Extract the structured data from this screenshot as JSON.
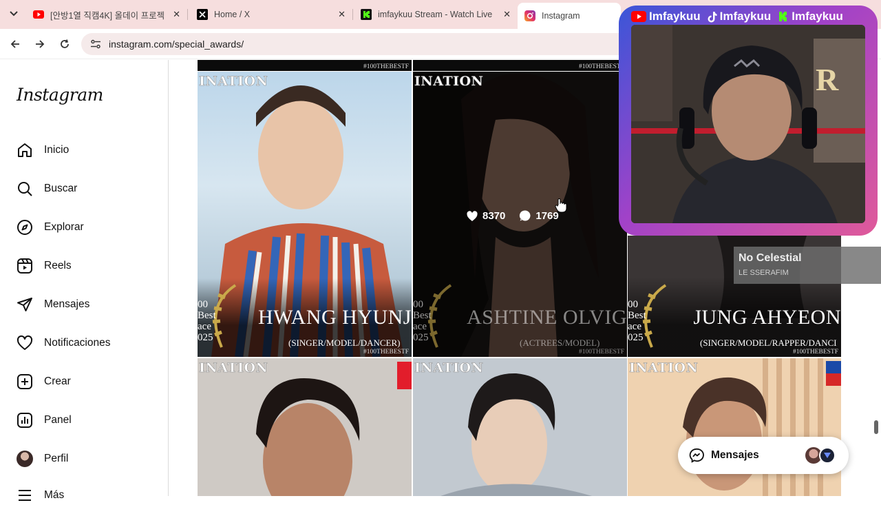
{
  "browser": {
    "tabs": [
      {
        "title": "[안방1열 직캠4K] 올데이 프로젝",
        "icon": "youtube-icon"
      },
      {
        "title": "Home / X",
        "icon": "x-icon"
      },
      {
        "title": "imfaykuu Stream - Watch Live o",
        "icon": "kick-icon"
      },
      {
        "title": "Instagram",
        "icon": "instagram-icon"
      }
    ],
    "url": "instagram.com/special_awards/"
  },
  "sidebar": {
    "logo": "Instagram",
    "items": [
      {
        "label": "Inicio",
        "icon": "home-icon"
      },
      {
        "label": "Buscar",
        "icon": "search-icon"
      },
      {
        "label": "Explorar",
        "icon": "compass-icon"
      },
      {
        "label": "Reels",
        "icon": "reels-icon"
      },
      {
        "label": "Mensajes",
        "icon": "send-icon"
      },
      {
        "label": "Notificaciones",
        "icon": "heart-icon"
      },
      {
        "label": "Crear",
        "icon": "plus-square-icon"
      },
      {
        "label": "Panel",
        "icon": "chart-icon"
      },
      {
        "label": "Perfil",
        "icon": "avatar"
      },
      {
        "label": "Más",
        "icon": "menu-icon"
      }
    ]
  },
  "posts": {
    "banner": "INATION",
    "hashtag": "#100THEBESTF",
    "laurel_a": "00",
    "laurel_b": "Best",
    "laurel_c": "ace",
    "laurel_d": "025",
    "row1": [
      {
        "name": "HWANG HYUNJ",
        "role": "(SINGER/MODEL/DANCER)"
      },
      {
        "name": "ASHTINE OLVIG",
        "role": "(ACTREES/MODEL)",
        "likes": "8370",
        "comments": "1769"
      },
      {
        "name": "JUNG AHYEON",
        "role": "(SINGER/MODEL/RAPPER/DANCI"
      }
    ]
  },
  "stream_overlay": {
    "handles": [
      "Imfaykuu",
      "Imfaykuu",
      "Imfaykuu"
    ],
    "icons": [
      "youtube-icon",
      "tiktok-icon",
      "kick-icon"
    ]
  },
  "now_playing": {
    "title": "No Celestial",
    "artist": "LE SSERAFIM"
  },
  "messages_button": {
    "label": "Mensajes"
  }
}
